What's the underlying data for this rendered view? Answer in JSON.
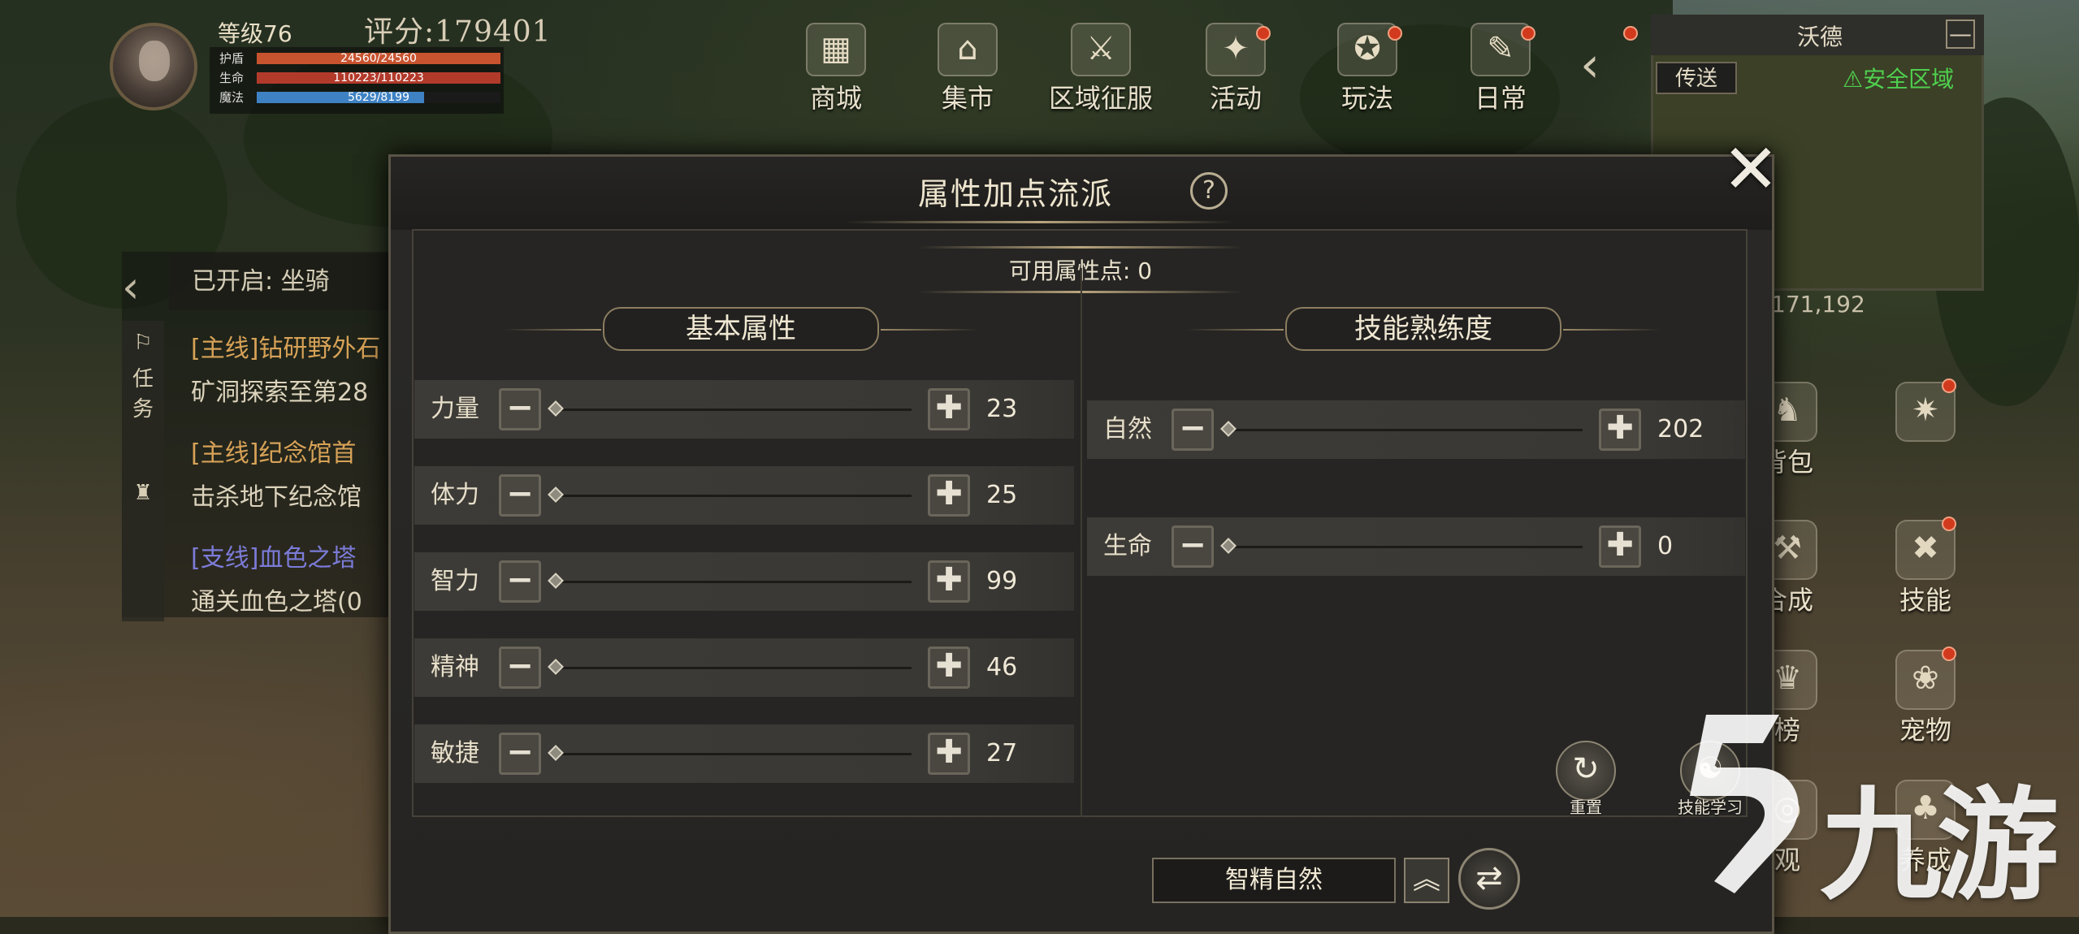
{
  "player": {
    "level": "等级76",
    "score": "评分:179401",
    "stats": [
      {
        "label": "护盾",
        "value": "24560/24560",
        "fill": 1.0,
        "color": "#c7532f"
      },
      {
        "label": "生命",
        "value": "110223/110223",
        "fill": 1.0,
        "color": "#b23a2b"
      },
      {
        "label": "魔法",
        "value": "5629/8199",
        "fill": 0.687,
        "color": "#3f82c4"
      }
    ]
  },
  "topmenu": [
    {
      "label": "商城",
      "icon": "shop-icon",
      "glyph": "▦"
    },
    {
      "label": "集市",
      "icon": "market-icon",
      "glyph": "⌂"
    },
    {
      "label": "区域征服",
      "icon": "conquest-icon",
      "glyph": "⚔"
    },
    {
      "label": "活动",
      "icon": "event-icon",
      "glyph": "✦"
    },
    {
      "label": "玩法",
      "icon": "gameplay-icon",
      "glyph": "✪"
    },
    {
      "label": "日常",
      "icon": "daily-icon",
      "glyph": "✎"
    }
  ],
  "minimap": {
    "title": "沃德",
    "teleport": "传送",
    "safe_zone": "安全区域",
    "close": "—",
    "coords": "171,192"
  },
  "quests": {
    "opened": "已开启: 坐骑",
    "tabs": [
      "任",
      "务"
    ],
    "items": [
      {
        "title": "[主线]钻研野外石",
        "desc": "矿洞探索至第28"
      },
      {
        "title": "[主线]纪念馆首",
        "desc": "击杀地下纪念馆"
      },
      {
        "title": "[支线]血色之塔",
        "desc": "通关血色之塔(0"
      }
    ]
  },
  "side": [
    {
      "label": "背包",
      "icon": "bag-icon",
      "glyph": "♞"
    },
    {
      "label": "",
      "icon": "compass-icon",
      "glyph": "✷"
    },
    {
      "label": "合成",
      "icon": "craft-icon",
      "glyph": "⚒"
    },
    {
      "label": "技能",
      "icon": "skill-icon",
      "glyph": "✖"
    },
    {
      "label": "榜",
      "icon": "rank-icon",
      "glyph": "♛"
    },
    {
      "label": "宠物",
      "icon": "pet-icon",
      "glyph": "❀"
    },
    {
      "label": "观",
      "icon": "view-icon",
      "glyph": "◎"
    },
    {
      "label": "养成",
      "icon": "grow-icon",
      "glyph": "♣"
    }
  ],
  "dialog": {
    "title": "属性加点流派",
    "help": "?",
    "close": "✕",
    "available_points": "可用属性点: 0",
    "basic_header": "基本属性",
    "skill_header": "技能熟练度",
    "basic": [
      {
        "label": "力量",
        "value": "23",
        "level": 0.0
      },
      {
        "label": "体力",
        "value": "25",
        "level": 0.0
      },
      {
        "label": "智力",
        "value": "99",
        "level": 0.0
      },
      {
        "label": "精神",
        "value": "46",
        "level": 0.0
      },
      {
        "label": "敏捷",
        "value": "27",
        "level": 0.0
      }
    ],
    "skills": [
      {
        "label": "自然",
        "value": "202",
        "level": 0.0
      },
      {
        "label": "生命",
        "value": "0",
        "level": 0.0
      }
    ],
    "minus": "−",
    "plus": "✚",
    "reset_label": "重置",
    "skill_learn_label": "技能学习",
    "preset_name": "智精自然",
    "preset_up": "︽",
    "swap": "⇄"
  },
  "watermark": {
    "text": "九游"
  }
}
